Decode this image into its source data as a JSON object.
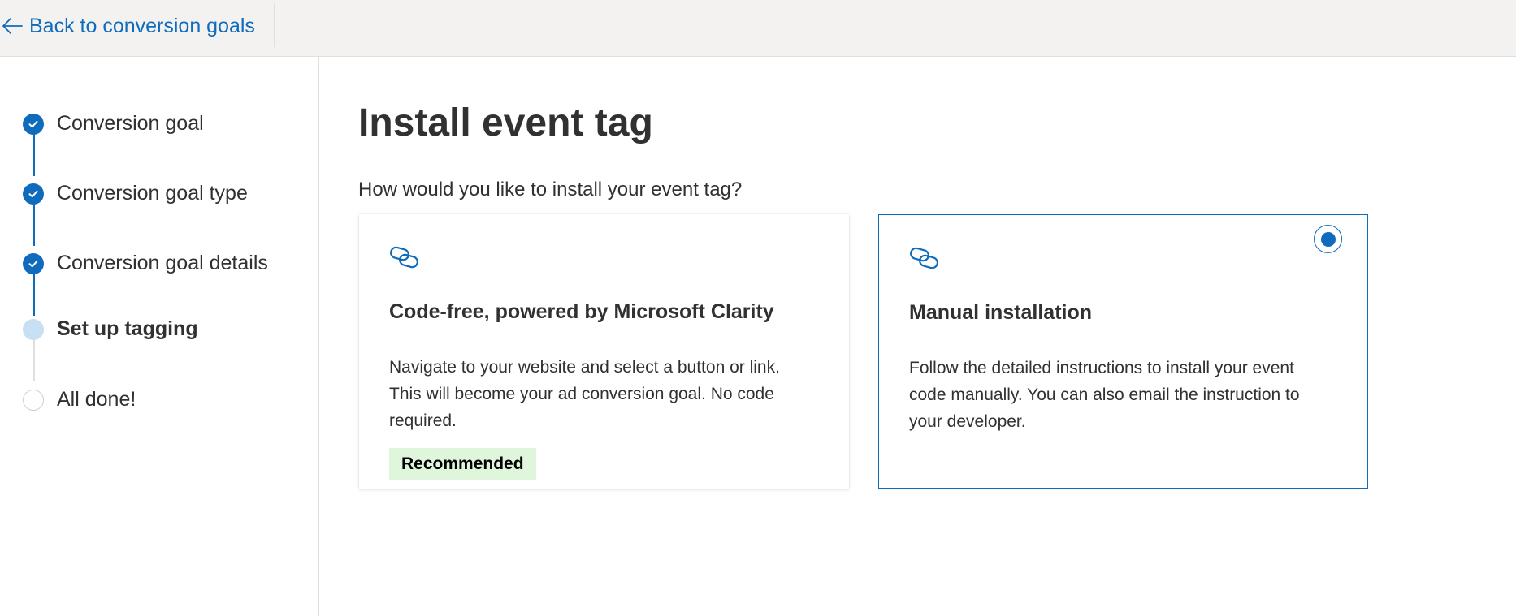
{
  "topbar": {
    "back_label": "Back to conversion goals"
  },
  "stepper": {
    "steps": [
      {
        "label": "Conversion goal",
        "state": "done"
      },
      {
        "label": "Conversion goal type",
        "state": "done"
      },
      {
        "label": "Conversion goal details",
        "state": "done"
      },
      {
        "label": "Set up tagging",
        "state": "current"
      },
      {
        "label": "All done!",
        "state": "pending"
      }
    ]
  },
  "main": {
    "title": "Install event tag",
    "question": "How would you like to install your event tag?",
    "options": [
      {
        "icon": "link-icon",
        "title": "Code-free, powered by Microsoft Clarity",
        "description": "Navigate to your website and select a button or link. This will become your ad conversion goal. No code required.",
        "badge": "Recommended",
        "selected": false
      },
      {
        "icon": "link-icon",
        "title": "Manual installation",
        "description": "Follow the detailed instructions to install your event code manually. You can also email the instruction to your developer.",
        "selected": true
      }
    ]
  },
  "colors": {
    "accent": "#0f6cbd",
    "current_step": "#c7e0f4",
    "badge_bg": "#dff6dd",
    "topbar_bg": "#f3f2f1"
  }
}
